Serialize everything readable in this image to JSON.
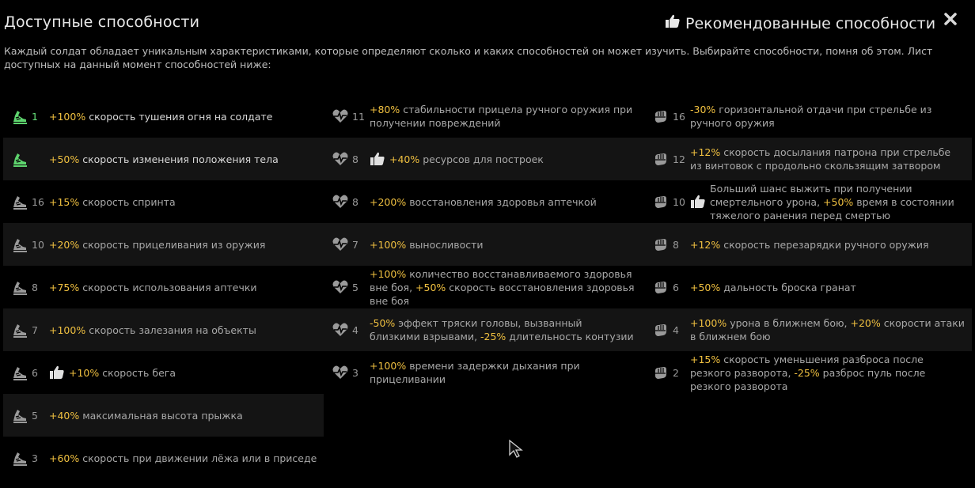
{
  "header": {
    "title": "Доступные способности",
    "recommended_label": "Рекомендованные способности",
    "description": "Каждый солдат обладает уникальным характеристиками, которые определяют сколько и каких способностей он может изучить. Выбирайте способности, помня об этом. Лист доступных на данный момент способностей ниже:"
  },
  "colors": {
    "highlight": "#f0c040",
    "active": "#5ed46e",
    "text": "#a8a8a8",
    "row_alt": "#141414"
  },
  "columns": [
    {
      "icon": "boot-icon",
      "items": [
        {
          "level": "1",
          "active": true,
          "recommended": false,
          "parts": [
            [
              "+100%",
              true
            ],
            [
              " скорость тушения огня на солдате",
              false
            ]
          ]
        },
        {
          "level": "",
          "active": true,
          "recommended": false,
          "parts": [
            [
              "+50%",
              true
            ],
            [
              " скорость изменения положения тела",
              false
            ]
          ]
        },
        {
          "level": "16",
          "active": false,
          "recommended": false,
          "parts": [
            [
              "+15%",
              true
            ],
            [
              " скорость спринта",
              false
            ]
          ]
        },
        {
          "level": "10",
          "active": false,
          "recommended": false,
          "parts": [
            [
              "+20%",
              true
            ],
            [
              " скорость прицеливания из оружия",
              false
            ]
          ]
        },
        {
          "level": "8",
          "active": false,
          "recommended": false,
          "parts": [
            [
              "+75%",
              true
            ],
            [
              " скорость использования аптечки",
              false
            ]
          ]
        },
        {
          "level": "7",
          "active": false,
          "recommended": false,
          "parts": [
            [
              "+100%",
              true
            ],
            [
              " скорость залезания на объекты",
              false
            ]
          ]
        },
        {
          "level": "6",
          "active": false,
          "recommended": true,
          "parts": [
            [
              "+10%",
              true
            ],
            [
              " скорость бега",
              false
            ]
          ]
        },
        {
          "level": "5",
          "active": false,
          "recommended": false,
          "parts": [
            [
              "+40%",
              true
            ],
            [
              " максимальная высота прыжка",
              false
            ]
          ]
        },
        {
          "level": "3",
          "active": false,
          "recommended": false,
          "parts": [
            [
              "+60%",
              true
            ],
            [
              " скорость при движении лёжа или в приседе",
              false
            ]
          ]
        }
      ]
    },
    {
      "icon": "heart-icon",
      "items": [
        {
          "level": "11",
          "active": false,
          "recommended": false,
          "parts": [
            [
              "+80%",
              true
            ],
            [
              " стабильности прицела ручного оружия при\nполучении повреждений",
              false
            ]
          ]
        },
        {
          "level": "8",
          "active": false,
          "recommended": true,
          "parts": [
            [
              "+40%",
              true
            ],
            [
              " ресурсов для построек",
              false
            ]
          ]
        },
        {
          "level": "8",
          "active": false,
          "recommended": false,
          "parts": [
            [
              "+200%",
              true
            ],
            [
              " восстановления здоровья аптечкой",
              false
            ]
          ]
        },
        {
          "level": "7",
          "active": false,
          "recommended": false,
          "parts": [
            [
              "+100%",
              true
            ],
            [
              " выносливости",
              false
            ]
          ]
        },
        {
          "level": "5",
          "active": false,
          "recommended": false,
          "parts": [
            [
              "+100%",
              true
            ],
            [
              " количество восстанавливаемого здоровья\nвне боя, ",
              false
            ],
            [
              "+50%",
              true
            ],
            [
              " скорость восстановления здоровья\nвне боя",
              false
            ]
          ]
        },
        {
          "level": "4",
          "active": false,
          "recommended": false,
          "parts": [
            [
              "-50%",
              true
            ],
            [
              " эффект тряски головы, вызванный\nблизкими взрывами, ",
              false
            ],
            [
              "-25%",
              true
            ],
            [
              " длительность контузии",
              false
            ]
          ]
        },
        {
          "level": "3",
          "active": false,
          "recommended": false,
          "parts": [
            [
              "+100%",
              true
            ],
            [
              " времени задержки дыхания при\nприцеливании",
              false
            ]
          ]
        }
      ]
    },
    {
      "icon": "fist-icon",
      "items": [
        {
          "level": "16",
          "active": false,
          "recommended": false,
          "parts": [
            [
              "-30%",
              true
            ],
            [
              " горизонтальной отдачи при стрельбе из\nручного оружия",
              false
            ]
          ]
        },
        {
          "level": "12",
          "active": false,
          "recommended": false,
          "parts": [
            [
              "+12%",
              true
            ],
            [
              " скорость досылания патрона при стрельбе\nиз винтовок с продольно скользящим затвором",
              false
            ]
          ]
        },
        {
          "level": "10",
          "active": false,
          "recommended": true,
          "parts": [
            [
              "Больший шанс выжить при получении\nсмертельного урона, ",
              false
            ],
            [
              "+50%",
              true
            ],
            [
              " время в состоянии\nтяжелого ранения перед смертью",
              false
            ]
          ]
        },
        {
          "level": "8",
          "active": false,
          "recommended": false,
          "parts": [
            [
              "+12%",
              true
            ],
            [
              " скорость перезарядки ручного оружия",
              false
            ]
          ]
        },
        {
          "level": "6",
          "active": false,
          "recommended": false,
          "parts": [
            [
              "+50%",
              true
            ],
            [
              " дальность броска гранат",
              false
            ]
          ]
        },
        {
          "level": "4",
          "active": false,
          "recommended": false,
          "parts": [
            [
              "+100%",
              true
            ],
            [
              " урона в ближнем бою, ",
              false
            ],
            [
              "+20%",
              true
            ],
            [
              " скорости атаки\nв ближнем бою",
              false
            ]
          ]
        },
        {
          "level": "2",
          "active": false,
          "recommended": false,
          "parts": [
            [
              "+15%",
              true
            ],
            [
              " скорость уменьшения разброса после\nрезкого разворота, ",
              false
            ],
            [
              "-25%",
              true
            ],
            [
              " разброс пуль после\nрезкого разворота",
              false
            ]
          ]
        }
      ]
    }
  ]
}
